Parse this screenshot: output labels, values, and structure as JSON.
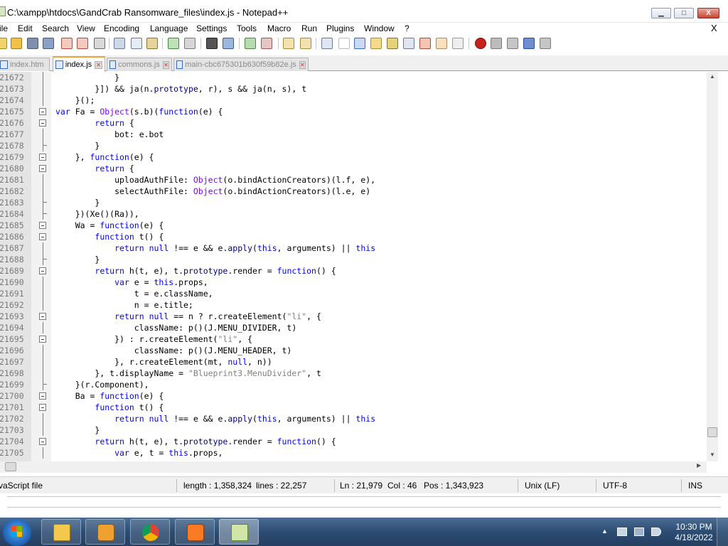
{
  "window": {
    "title": "C:\\xampp\\htdocs\\GandCrab Ransomware_files\\index.js - Notepad++",
    "min_glyph": "▁",
    "max_glyph": "□",
    "close_glyph": "X"
  },
  "menu": {
    "items": [
      "ile",
      "Edit",
      "Search",
      "View",
      "Encoding",
      "Language",
      "Settings",
      "Tools",
      "Macro",
      "Run",
      "Plugins",
      "Window",
      "?"
    ],
    "close_doc": "X"
  },
  "tabs": [
    {
      "label": "index.htm",
      "active": false
    },
    {
      "label": "index.js",
      "active": true
    },
    {
      "label": "commons.js",
      "active": false
    },
    {
      "label": "main-cbc675301b630f59b82e.js",
      "active": false
    }
  ],
  "editor": {
    "lines": [
      {
        "n": "21672",
        "t": "            }"
      },
      {
        "n": "21673",
        "t": "        }]) && ja(n.prototype, r), s && ja(n, s), t"
      },
      {
        "n": "21674",
        "t": "    }();"
      },
      {
        "n": "21675",
        "t": "var Fa = Object(s.b)(function(e) {"
      },
      {
        "n": "21676",
        "t": "        return {"
      },
      {
        "n": "21677",
        "t": "            bot: e.bot"
      },
      {
        "n": "21678",
        "t": "        }"
      },
      {
        "n": "21679",
        "t": "    }, function(e) {"
      },
      {
        "n": "21680",
        "t": "        return {"
      },
      {
        "n": "21681",
        "t": "            uploadAuthFile: Object(o.bindActionCreators)(l.f, e),"
      },
      {
        "n": "21682",
        "t": "            selectAuthFile: Object(o.bindActionCreators)(l.e, e)"
      },
      {
        "n": "21683",
        "t": "        }"
      },
      {
        "n": "21684",
        "t": "    })(Xe()(Ra)),"
      },
      {
        "n": "21685",
        "t": "    Wa = function(e) {"
      },
      {
        "n": "21686",
        "t": "        function t() {"
      },
      {
        "n": "21687",
        "t": "            return null !== e && e.apply(this, arguments) || this"
      },
      {
        "n": "21688",
        "t": "        }"
      },
      {
        "n": "21689",
        "t": "        return h(t, e), t.prototype.render = function() {"
      },
      {
        "n": "21690",
        "t": "            var e = this.props,"
      },
      {
        "n": "21691",
        "t": "                t = e.className,"
      },
      {
        "n": "21692",
        "t": "                n = e.title;"
      },
      {
        "n": "21693",
        "t": "            return null == n ? r.createElement(\"li\", {"
      },
      {
        "n": "21694",
        "t": "                className: p()(J.MENU_DIVIDER, t)"
      },
      {
        "n": "21695",
        "t": "            }) : r.createElement(\"li\", {"
      },
      {
        "n": "21696",
        "t": "                className: p()(J.MENU_HEADER, t)"
      },
      {
        "n": "21697",
        "t": "            }, r.createElement(mt, null, n))"
      },
      {
        "n": "21698",
        "t": "        }, t.displayName = \"Blueprint3.MenuDivider\", t"
      },
      {
        "n": "21699",
        "t": "    }(r.Component),"
      },
      {
        "n": "21700",
        "t": "    Ba = function(e) {"
      },
      {
        "n": "21701",
        "t": "        function t() {"
      },
      {
        "n": "21702",
        "t": "            return null !== e && e.apply(this, arguments) || this"
      },
      {
        "n": "21703",
        "t": "        }"
      },
      {
        "n": "21704",
        "t": "        return h(t, e), t.prototype.render = function() {"
      },
      {
        "n": "21705",
        "t": "            var e, t = this.props,"
      }
    ]
  },
  "status": {
    "file_type": "vaScript file",
    "length": "length : 1,358,324",
    "lines": "lines : 22,257",
    "ln": "Ln : 21,979",
    "col": "Col : 46",
    "pos": "Pos : 1,343,923",
    "eol": "Unix (LF)",
    "encoding": "UTF-8",
    "mode": "INS"
  },
  "taskbar": {
    "time": "10:30 PM",
    "date": "4/18/2022"
  },
  "colors": {
    "keyword": "#0000ff",
    "function_call": "#8000ff",
    "string": "#808080",
    "active_tab_accent": "#f3a23a"
  }
}
